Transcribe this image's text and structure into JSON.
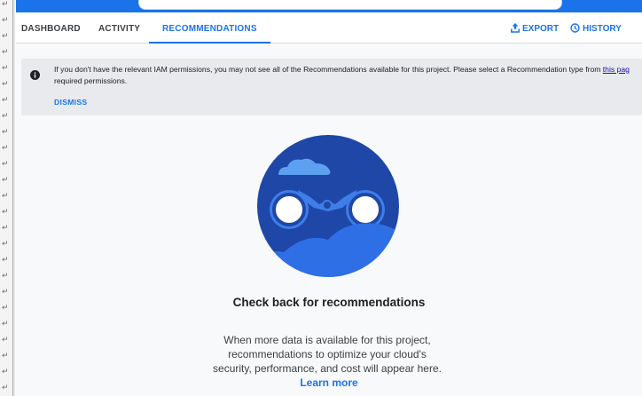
{
  "tabs": [
    {
      "label": "DASHBOARD"
    },
    {
      "label": "ACTIVITY"
    },
    {
      "label": "RECOMMENDATIONS",
      "active": true
    }
  ],
  "actions": {
    "export_label": "EXPORT",
    "history_label": "HISTORY"
  },
  "banner": {
    "message_before_link": "If you don't have the relevant IAM permissions, you may not see all of the Recommendations available for this project. Please select a Recommendation type from ",
    "link_text": "this pag",
    "message_line2": "required permissions.",
    "dismiss_label": "DISMISS"
  },
  "empty_state": {
    "title": "Check back for recommendations",
    "line1": "When more data is available for this project,",
    "line2": "recommendations to optimize your cloud's",
    "line3": "security, performance, and cost will appear here.",
    "learn_more": "Learn more"
  },
  "icons": {
    "info": "info-icon",
    "export": "export-icon",
    "history": "history-icon",
    "illustration": "binoculars-illustration",
    "gutter": "return-arrow-icon"
  },
  "colors": {
    "accent": "#1a73e8",
    "illustration_dark": "#1e47a8",
    "illustration_mid": "#3f7de8",
    "banner_bg": "#e8eaed"
  }
}
